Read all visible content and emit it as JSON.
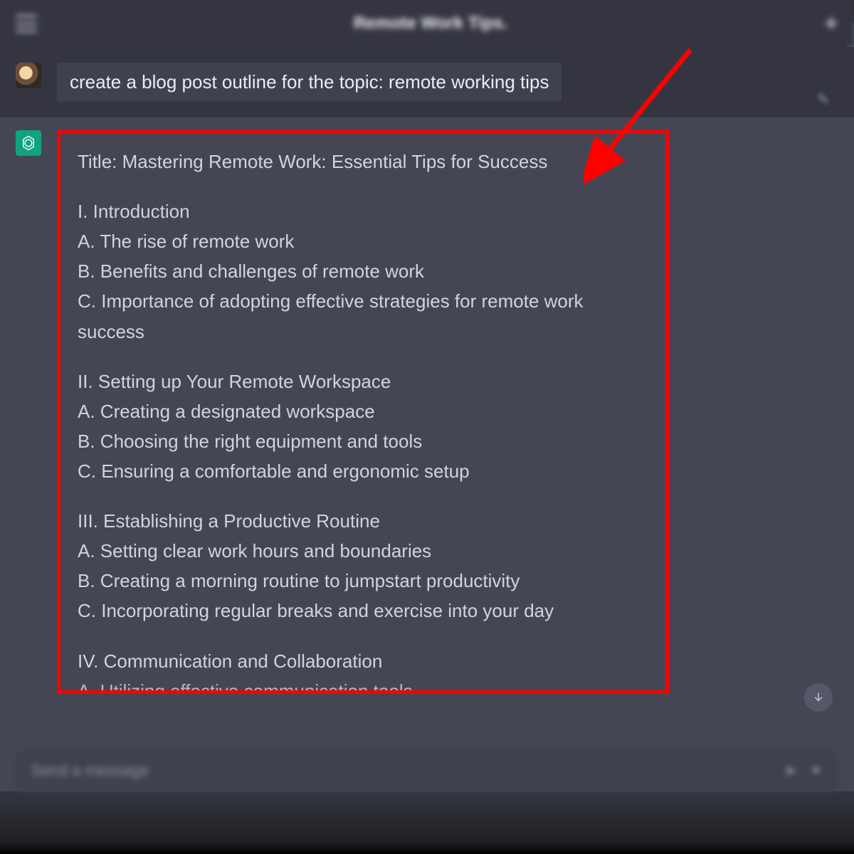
{
  "header": {
    "title": "Remote Work Tips."
  },
  "user_message": {
    "text": "create a blog post outline for the topic: remote working tips"
  },
  "assistant_message": {
    "title_line": "Title: Mastering Remote Work: Essential Tips for Success",
    "sections": [
      {
        "heading": "I. Introduction",
        "items": [
          "A. The rise of remote work",
          "B. Benefits and challenges of remote work",
          "C. Importance of adopting effective strategies for remote work success"
        ]
      },
      {
        "heading": "II. Setting up Your Remote Workspace",
        "items": [
          "A. Creating a designated workspace",
          "B. Choosing the right equipment and tools",
          "C. Ensuring a comfortable and ergonomic setup"
        ]
      },
      {
        "heading": "III. Establishing a Productive Routine",
        "items": [
          "A. Setting clear work hours and boundaries",
          "B. Creating a morning routine to jumpstart productivity",
          "C. Incorporating regular breaks and exercise into your day"
        ]
      },
      {
        "heading": "IV. Communication and Collaboration",
        "items": [
          "A. Utilizing effective communication tools"
        ]
      }
    ]
  },
  "input": {
    "placeholder": "Send a message"
  },
  "annotation": {
    "highlight_color": "#ff0000"
  }
}
